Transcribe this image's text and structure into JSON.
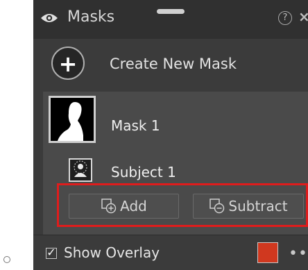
{
  "panel": {
    "title": "Masks",
    "help_glyph": "?",
    "close_glyph": "×",
    "icons": {
      "visibility": "eye-icon",
      "grip": "drag-handle-icon",
      "help": "help-circle-icon",
      "close": "close-icon"
    }
  },
  "create": {
    "label": "Create New Mask",
    "glyph": "+"
  },
  "mask": {
    "name": "Mask 1",
    "component": "Subject 1",
    "thumbnail_icon": "person-silhouette-icon",
    "subject_icon": "subject-person-icon"
  },
  "actions": {
    "add_label": "Add",
    "subtract_label": "Subtract",
    "add_icon": "add-mask-icon",
    "subtract_icon": "subtract-mask-icon"
  },
  "footer": {
    "show_overlay_label": "Show Overlay",
    "show_overlay_checked": true,
    "check_glyph": "✓",
    "overlay_color": "#d0381f",
    "more_glyph": "•••"
  },
  "colors": {
    "panel_bg": "#3b3b3b",
    "header_bg": "#303030",
    "selected_group_bg": "#4a4a4a",
    "highlight_border": "#e01c1c"
  }
}
